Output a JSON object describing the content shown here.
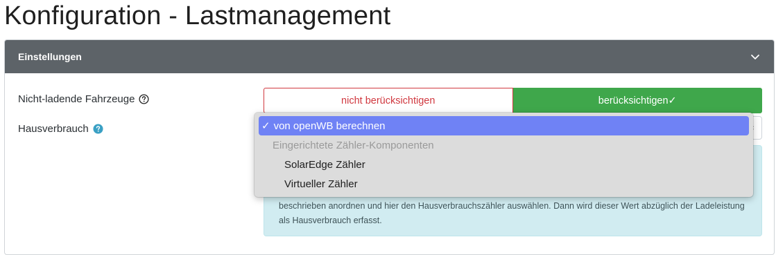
{
  "page": {
    "title": "Konfiguration - Lastmanagement"
  },
  "card": {
    "header_title": "Einstellungen"
  },
  "settings": {
    "vehicles_label": "Nicht-ladende Fahrzeuge",
    "vehicles_off": "nicht berücksichtigen",
    "vehicles_on": "berücksichtigen✓",
    "house_label": "Hausverbrauch"
  },
  "dropdown": {
    "selected": "von openWB berechnen",
    "selected_check": "✓",
    "group_label": "Eingerichtete Zähler-Komponenten",
    "options": [
      "SolarEdge Zähler",
      "Virtueller Zähler"
    ]
  },
  "info": {
    "text": "beschrieben anordnen und hier den Hausverbrauchszähler auswählen. Dann wird dieser Wert abzüglich der Ladeleistung als Hausverbrauch erfasst."
  },
  "colors": {
    "header_bg": "#5d6368",
    "danger": "#d0383f",
    "success": "#3fa74b",
    "info_bg": "#d1ecf1",
    "help_icon": "#3aa0c4",
    "select_highlight": "#6f82f5"
  },
  "icons": {
    "header": "chevron-down-icon",
    "vehicles_help": "question-circle-icon",
    "house_help": "question-circle-filled-icon",
    "select": "select-arrows-icon"
  }
}
